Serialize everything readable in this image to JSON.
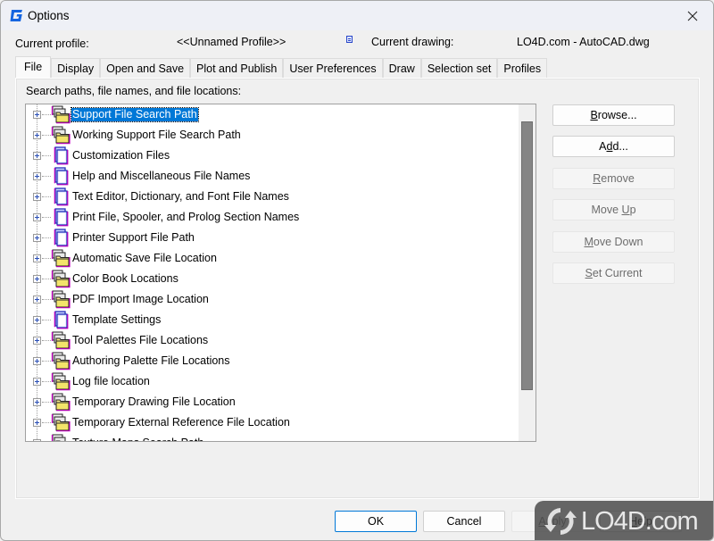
{
  "window": {
    "title": "Options",
    "app_icon": "gstarcad-g-logo-icon",
    "close_icon": "close-icon",
    "brand_color": "#1565e0"
  },
  "profile": {
    "current_profile_label": "Current profile:",
    "current_profile_value": "<<Unnamed Profile>>",
    "drawing_icon": "drawing-file-icon",
    "current_drawing_label": "Current drawing:",
    "current_drawing_value": "LO4D.com - AutoCAD.dwg"
  },
  "tabs": [
    {
      "label": "File",
      "active": true
    },
    {
      "label": "Display",
      "active": false
    },
    {
      "label": "Open and Save",
      "active": false
    },
    {
      "label": "Plot and Publish",
      "active": false
    },
    {
      "label": "User Preferences",
      "active": false
    },
    {
      "label": "Draw",
      "active": false
    },
    {
      "label": "Selection set",
      "active": false
    },
    {
      "label": "Profiles",
      "active": false
    }
  ],
  "file_tab": {
    "section_label": "Search paths, file names, and file locations:",
    "tree_items": [
      {
        "label": "Support File Search Path",
        "icon": "folders",
        "selected": true
      },
      {
        "label": "Working Support File Search Path",
        "icon": "folders",
        "selected": false
      },
      {
        "label": "Customization Files",
        "icon": "files",
        "selected": false
      },
      {
        "label": "Help and Miscellaneous File Names",
        "icon": "files",
        "selected": false
      },
      {
        "label": "Text Editor, Dictionary, and Font File Names",
        "icon": "files",
        "selected": false
      },
      {
        "label": "Print File, Spooler, and Prolog Section Names",
        "icon": "files",
        "selected": false
      },
      {
        "label": "Printer Support File Path",
        "icon": "files",
        "selected": false
      },
      {
        "label": "Automatic Save File Location",
        "icon": "folders",
        "selected": false
      },
      {
        "label": "Color Book Locations",
        "icon": "folders",
        "selected": false
      },
      {
        "label": "PDF Import Image Location",
        "icon": "folders",
        "selected": false
      },
      {
        "label": "Template Settings",
        "icon": "files",
        "selected": false
      },
      {
        "label": "Tool Palettes File Locations",
        "icon": "folders",
        "selected": false
      },
      {
        "label": "Authoring Palette File Locations",
        "icon": "folders",
        "selected": false
      },
      {
        "label": "Log file location",
        "icon": "folders",
        "selected": false
      },
      {
        "label": "Temporary Drawing File Location",
        "icon": "folders",
        "selected": false
      },
      {
        "label": "Temporary External Reference File Location",
        "icon": "folders",
        "selected": false
      },
      {
        "label": "Texture Maps Search Path",
        "icon": "folders",
        "selected": false
      }
    ],
    "buttons": {
      "browse": {
        "pre": "",
        "mnemonic": "B",
        "post": "rowse...",
        "enabled": true
      },
      "add": {
        "pre": "A",
        "mnemonic": "d",
        "post": "d...",
        "enabled": true
      },
      "remove": {
        "pre": "",
        "mnemonic": "R",
        "post": "emove",
        "enabled": false
      },
      "move_up": {
        "pre": "Move ",
        "mnemonic": "U",
        "post": "p",
        "enabled": false
      },
      "move_down": {
        "pre": "",
        "mnemonic": "M",
        "post": "ove Down",
        "enabled": false
      },
      "set_current": {
        "pre": "",
        "mnemonic": "S",
        "post": "et Current",
        "enabled": false
      }
    }
  },
  "footer": {
    "ok": "OK",
    "cancel": "Cancel",
    "apply": {
      "pre": "",
      "mnemonic": "A",
      "post": "pply",
      "enabled": false
    },
    "help": {
      "pre": "",
      "mnemonic": "H",
      "post": "elp",
      "enabled": true
    }
  },
  "watermark": {
    "text": "LO4D.com"
  }
}
